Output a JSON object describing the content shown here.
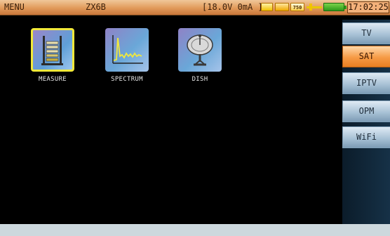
{
  "status_bar": {
    "screen_name": "MENU",
    "device_model": "ZX6B",
    "power_readout": "[18.0V 0mA ]",
    "indicator_750": "750",
    "clock": "17:02:25",
    "icons": [
      "satellite-icon",
      "satellite-signal-icon",
      "impedance-750-icon",
      "cable-icon",
      "battery-icon"
    ]
  },
  "apps": [
    {
      "label": "MEASURE",
      "selected": true,
      "icon": "measure-bars-icon"
    },
    {
      "label": "SPECTRUM",
      "selected": false,
      "icon": "spectrum-graph-icon"
    },
    {
      "label": "DISH",
      "selected": false,
      "icon": "satellite-dish-icon"
    }
  ],
  "side_menu": [
    {
      "label": "TV",
      "active": false
    },
    {
      "label": "SAT",
      "active": true
    },
    {
      "label": "IPTV",
      "active": false
    },
    {
      "label": "OPM",
      "active": false
    },
    {
      "label": "WiFi",
      "active": false
    }
  ],
  "colors": {
    "status_bar": "#e19a5a",
    "active_button": "#f69a45",
    "inactive_button": "#a9c2d6",
    "selection_outline": "#f2e93a",
    "spectrum_trace": "#f2e93a"
  }
}
